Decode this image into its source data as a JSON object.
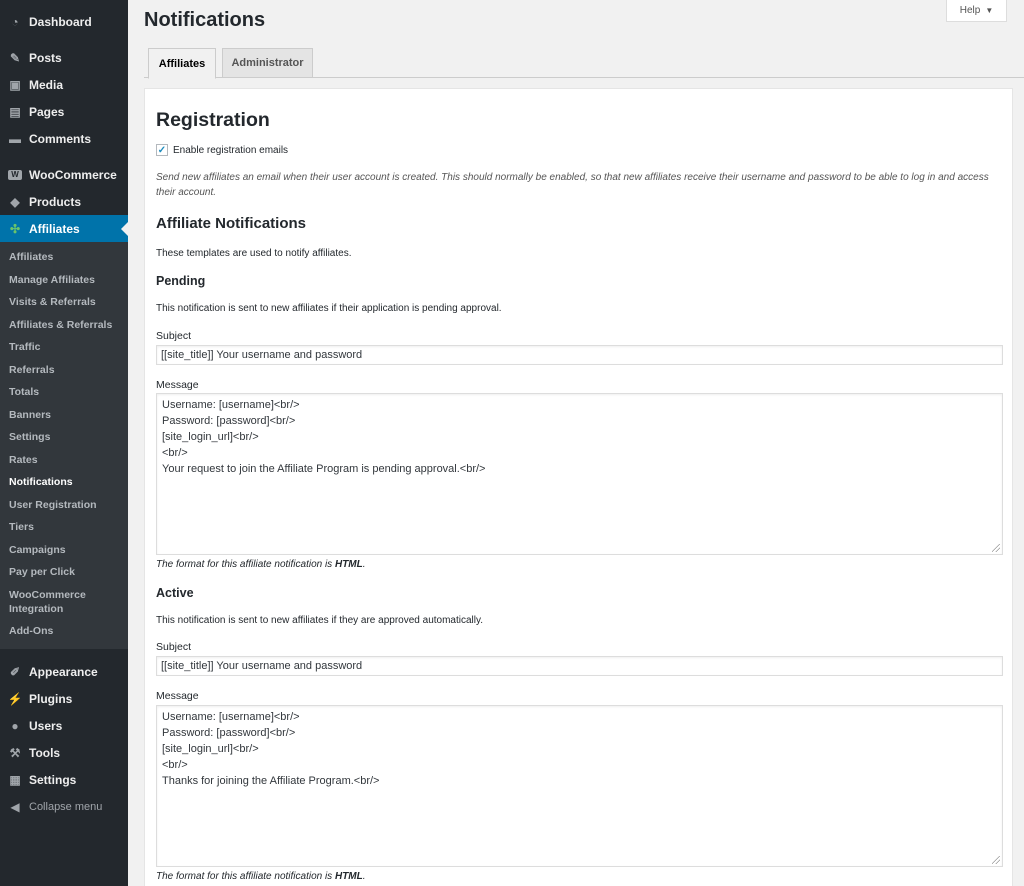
{
  "sidebar": {
    "top_items": [
      {
        "label": "Dashboard",
        "icon": "dashboard-icon"
      },
      {
        "label": "Posts",
        "icon": "pin-icon"
      },
      {
        "label": "Media",
        "icon": "media-icon"
      },
      {
        "label": "Pages",
        "icon": "pages-icon"
      },
      {
        "label": "Comments",
        "icon": "comments-icon"
      },
      {
        "label": "WooCommerce",
        "icon": "woocommerce-icon"
      },
      {
        "label": "Products",
        "icon": "products-icon"
      },
      {
        "label": "Affiliates",
        "icon": "affiliates-icon"
      }
    ],
    "submenu": [
      "Affiliates",
      "Manage Affiliates",
      "Visits & Referrals",
      "Affiliates & Referrals",
      "Traffic",
      "Referrals",
      "Totals",
      "Banners",
      "Settings",
      "Rates",
      "Notifications",
      "User Registration",
      "Tiers",
      "Campaigns",
      "Pay per Click",
      "WooCommerce Integration",
      "Add-Ons"
    ],
    "bottom_items": [
      {
        "label": "Appearance",
        "icon": "appearance-icon"
      },
      {
        "label": "Plugins",
        "icon": "plugins-icon"
      },
      {
        "label": "Users",
        "icon": "users-icon"
      },
      {
        "label": "Tools",
        "icon": "tools-icon"
      },
      {
        "label": "Settings",
        "icon": "settings-icon"
      }
    ],
    "collapse_label": "Collapse menu"
  },
  "header": {
    "title": "Notifications",
    "help_label": "Help"
  },
  "tabs": [
    {
      "label": "Affiliates",
      "active": true
    },
    {
      "label": "Administrator",
      "active": false
    }
  ],
  "registration": {
    "heading": "Registration",
    "checkbox_label": "Enable registration emails",
    "checked": true,
    "description": "Send new affiliates an email when their user account is created. This should normally be enabled, so that new affiliates receive their username and password to be able to log in and access their account."
  },
  "affiliate_notifications": {
    "heading": "Affiliate Notifications",
    "intro": "These templates are used to notify affiliates."
  },
  "pending": {
    "heading": "Pending",
    "description": "This notification is sent to new affiliates if their application is pending approval.",
    "subject_label": "Subject",
    "subject_value": "[[site_title]] Your username and password",
    "message_label": "Message",
    "message_value": "Username: [username]<br/>\nPassword: [password]<br/>\n[site_login_url]<br/>\n<br/>\nYour request to join the Affiliate Program is pending approval.<br/>",
    "format_prefix": "The format for this affiliate notification is ",
    "format_value": "HTML",
    "format_suffix": "."
  },
  "active": {
    "heading": "Active",
    "description": "This notification is sent to new affiliates if they are approved automatically.",
    "subject_label": "Subject",
    "subject_value": "[[site_title]] Your username and password",
    "message_label": "Message",
    "message_value": "Username: [username]<br/>\nPassword: [password]<br/>\n[site_login_url]<br/>\n<br/>\nThanks for joining the Affiliate Program.<br/>",
    "format_prefix": "The format for this affiliate notification is ",
    "format_value": "HTML",
    "format_suffix": "."
  },
  "colors": {
    "sidebar_bg": "#23282d",
    "submenu_bg": "#32373c",
    "accent": "#0073aa"
  }
}
